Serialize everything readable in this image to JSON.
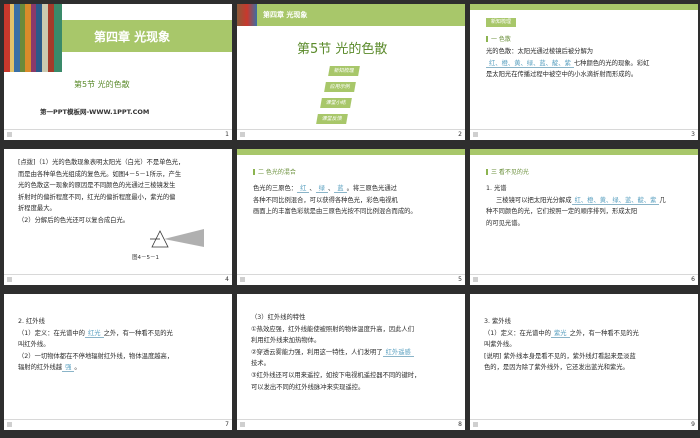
{
  "slides": [
    {
      "num": "1",
      "chapter": "第四章  光现象",
      "subtitle": "第5节    光的色散",
      "footer_text": "第一PPT模板网-WWW.1PPT.COM"
    },
    {
      "num": "2",
      "chapter": "第四章  光现象",
      "title": "第5节    光的色散",
      "buttons": [
        "新知梳理",
        "应用示例",
        "课堂小结",
        "课堂反馈"
      ]
    },
    {
      "num": "3",
      "tag": "新知梳理",
      "section": "一  色散",
      "lines": [
        "光的色散：太阳光通过棱镜后被分解为",
        "红、橙、黄、绿、蓝、靛、紫",
        "七种颜色的光的现象。彩虹",
        "是太阳光在传播过程中被空中的小水滴折射而形成的。"
      ]
    },
    {
      "num": "4",
      "lines": [
        "[点拨]（1）光的色散现象表明太阳光（白光）不是单色光，",
        "而是由各种单色光组成的复色光。如图4－5－1所示，产生",
        "光的色散这一现象的原因是不同颜色的光通过三棱镜发生",
        "折射时的偏折程度不同，红光的偏折程度最小，紫光的偏",
        "折程度最大。",
        "（2）分解后的色光还可以复合成白光。"
      ],
      "figure": "图4－5－1"
    },
    {
      "num": "5",
      "section": "二  色光的混合",
      "lines": [
        "色光的三原色：",
        "红",
        "、",
        "绿",
        "、",
        "蓝",
        "。将三原色光通过",
        "各种不同比例混合，可以获得各种色光，彩色电视机",
        "画面上的丰富色彩就是由三原色光按不同比例混合而成的。"
      ]
    },
    {
      "num": "6",
      "section": "三  看不见的光",
      "lines": [
        "1. 光谱",
        "三棱镜可以把太阳光分解成",
        "红、橙、黄、绿、蓝、靛、紫",
        "几",
        "种不同颜色的光，它们按照一定的顺序排列，形成太阳",
        "的可见光谱。"
      ]
    },
    {
      "num": "7",
      "lines": [
        "2. 红外线",
        "（1）定义：在光谱中的",
        "红光",
        "之外，有一种看不见的光",
        "叫红外线。",
        "（2）一切物体都在不停地辐射红外线，物体温度越高，",
        "辐射的红外线越",
        "强",
        "。"
      ]
    },
    {
      "num": "8",
      "lines": [
        "（3）红外线的特性",
        "①热效应强，红外线能使被照射的物体温度升高，因此人们",
        "利用红外线来加热物体。",
        "②穿透云雾能力强，利用这一特性，人们发明了",
        "红外遥感",
        "技术。",
        "③红外线还可以用来遥控，如按下电视机遥控器不同的键时，",
        "可以发出不同的红外线脉冲来实现遥控。"
      ]
    },
    {
      "num": "9",
      "lines": [
        "3. 紫外线",
        "（1）定义：在光谱中的",
        "紫光",
        "之外，有一种看不见的光",
        "叫紫外线。",
        "[说明] 紫外线本身是看不见的，紫外线灯看起来是淡蓝",
        "色的，是因为除了紫外线外，它还发出蓝光和紫光。"
      ]
    }
  ]
}
